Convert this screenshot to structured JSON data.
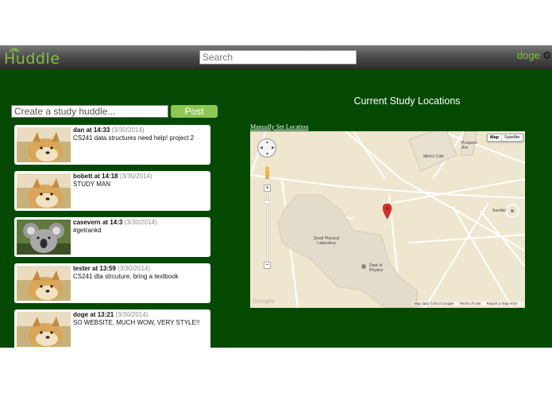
{
  "app": {
    "logo": "Huddle"
  },
  "search": {
    "placeholder": "Search"
  },
  "user": {
    "name": "doge"
  },
  "composer": {
    "placeholder": "Create a study huddle...",
    "post_label": "Post"
  },
  "posts": [
    {
      "author": "dan",
      "time": "14:33",
      "date": "(3/30/2014)",
      "body": "CS241 data structures need help! project 2",
      "avatar": "doge"
    },
    {
      "author": "bobett",
      "time": "14:18",
      "date": "(3/30/2014)",
      "body": "STUDY MAN",
      "avatar": "doge"
    },
    {
      "author": "casevern",
      "time": "14:3",
      "date": "(3/30/2014)",
      "body": "#getrankd",
      "avatar": "koala"
    },
    {
      "author": "tester",
      "time": "13:59",
      "date": "(3/30/2014)",
      "body": "CS241 dta strcuture, bring a textbook",
      "avatar": "doge"
    },
    {
      "author": "doge",
      "time": "13:21",
      "date": "(3/30/2014)",
      "body": "SO WEBSITE, MUCH WOW, VERY STYLE!!",
      "avatar": "doge"
    }
  ],
  "at_word": "at",
  "locations": {
    "title": "Current Study Locations",
    "manual_link": "Manually Set Location",
    "map_type": [
      "Map",
      "Satellite"
    ],
    "labels": {
      "cafe": "Mimi's Cafe",
      "ave": "Prospect Ave",
      "lab": "Small Physical Laboratory",
      "dept": "Dept of Physics",
      "sundial": "Sundial"
    },
    "google": "Google",
    "footer": [
      "Map data ©2014 Google",
      "Terms of Use",
      "Report a map error"
    ]
  },
  "colors": {
    "accent": "#7fc241",
    "background": "#034902",
    "post_button": "#8cc752"
  }
}
